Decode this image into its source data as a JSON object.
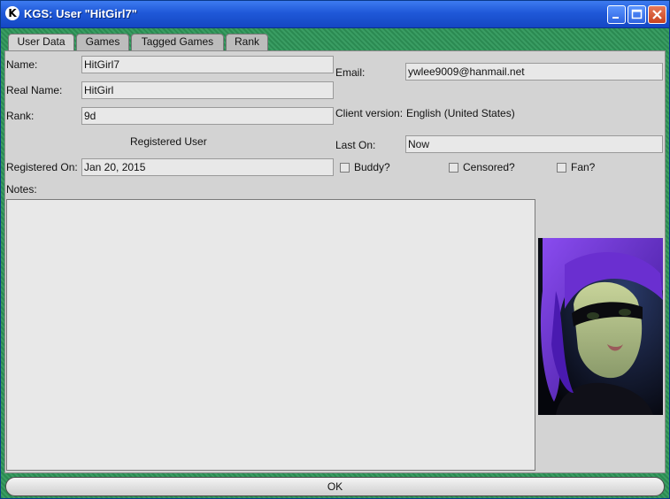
{
  "window": {
    "title": "KGS: User \"HitGirl7\"",
    "app_icon_letter": "K"
  },
  "tabs": [
    {
      "label": "User Data",
      "active": true
    },
    {
      "label": "Games",
      "active": false
    },
    {
      "label": "Tagged Games",
      "active": false
    },
    {
      "label": "Rank",
      "active": false
    }
  ],
  "user": {
    "name_label": "Name:",
    "name_value": "HitGirl7",
    "real_name_label": "Real Name:",
    "real_name_value": "HitGirl",
    "rank_label": "Rank:",
    "rank_value": "9d",
    "status": "Registered User",
    "registered_label": "Registered On:",
    "registered_value": "Jan 20, 2015",
    "notes_label": "Notes:",
    "notes_value": ""
  },
  "contact": {
    "email_label": "Email:",
    "email_value": "ywlee9009@hanmail.net",
    "client_label": "Client version:",
    "client_value": "English (United States)",
    "last_on_label": "Last On:",
    "last_on_value": "Now"
  },
  "checkboxes": [
    {
      "label": "Buddy?",
      "checked": false
    },
    {
      "label": "Censored?",
      "checked": false
    },
    {
      "label": "Fan?",
      "checked": false
    }
  ],
  "buttons": {
    "ok_label": "OK"
  },
  "colors": {
    "titlebar": "#1f58d8",
    "frame_green": "#2f8f55",
    "panel_bg": "#d3d3d3",
    "avatar_hair": "#6a2fd0"
  }
}
